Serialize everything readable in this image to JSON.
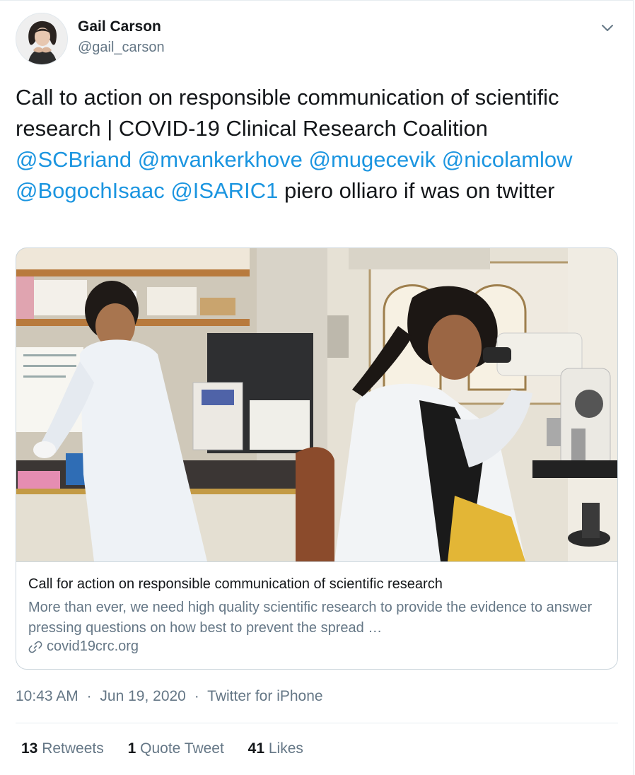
{
  "author": {
    "name": "Gail Carson",
    "handle": "@gail_carson",
    "avatar_icon": "profile-photo"
  },
  "tweet": {
    "text_before": "Call to action on responsible communication of scientific research | COVID-19 Clinical Research Coalition ",
    "mentions": [
      "@SCBriand",
      "@mvankerkhove",
      "@mugecevik",
      "@nicolamlow",
      "@BogochIsaac",
      "@ISARIC1"
    ],
    "text_after": " piero olliaro if was on twitter"
  },
  "card": {
    "title": "Call for action on responsible communication of scientific research",
    "description": "More than ever, we need high quality scientific research to provide the evidence to answer pressing questions on how best to prevent the spread …",
    "domain": "covid19crc.org",
    "image_icon": "lab-photo",
    "link_icon": "link-icon"
  },
  "meta": {
    "time": "10:43 AM",
    "date": "Jun 19, 2020",
    "separator": "·",
    "source": "Twitter for iPhone"
  },
  "stats": {
    "retweets_count": "13",
    "retweets_label": "Retweets",
    "quotes_count": "1",
    "quotes_label": "Quote Tweet",
    "likes_count": "41",
    "likes_label": "Likes"
  },
  "colors": {
    "link": "#1b95e0",
    "secondary_text": "#657786",
    "border": "#ccd6dd"
  }
}
